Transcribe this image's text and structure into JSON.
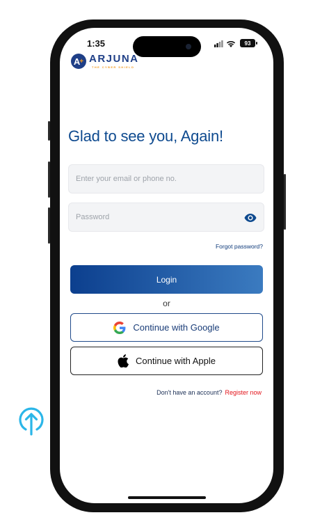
{
  "status_bar": {
    "time": "1:35",
    "battery": "93"
  },
  "brand": {
    "badge_letter": "A",
    "name": "ARJUNA",
    "tagline": "THE CYBER SHIELD"
  },
  "login": {
    "heading": "Glad to see you, Again!",
    "email_placeholder": "Enter your email or phone no.",
    "password_placeholder": "Password",
    "forgot_label": "Forgot password?",
    "login_label": "Login",
    "or_label": "or",
    "google_label": "Continue with Google",
    "apple_label": "Continue with Apple",
    "no_account_text": "Don't have an account?",
    "register_label": "Register now"
  },
  "colors": {
    "primary": "#0e4a8f",
    "button_gradient_start": "#0c3f8e",
    "button_gradient_end": "#3b7bc0",
    "register": "#e3131a",
    "upload_icon": "#2bb6e8"
  },
  "icons": {
    "password_toggle": "eye-icon",
    "google": "google-g-icon",
    "apple": "apple-icon",
    "floating": "upload-arrow-icon"
  }
}
